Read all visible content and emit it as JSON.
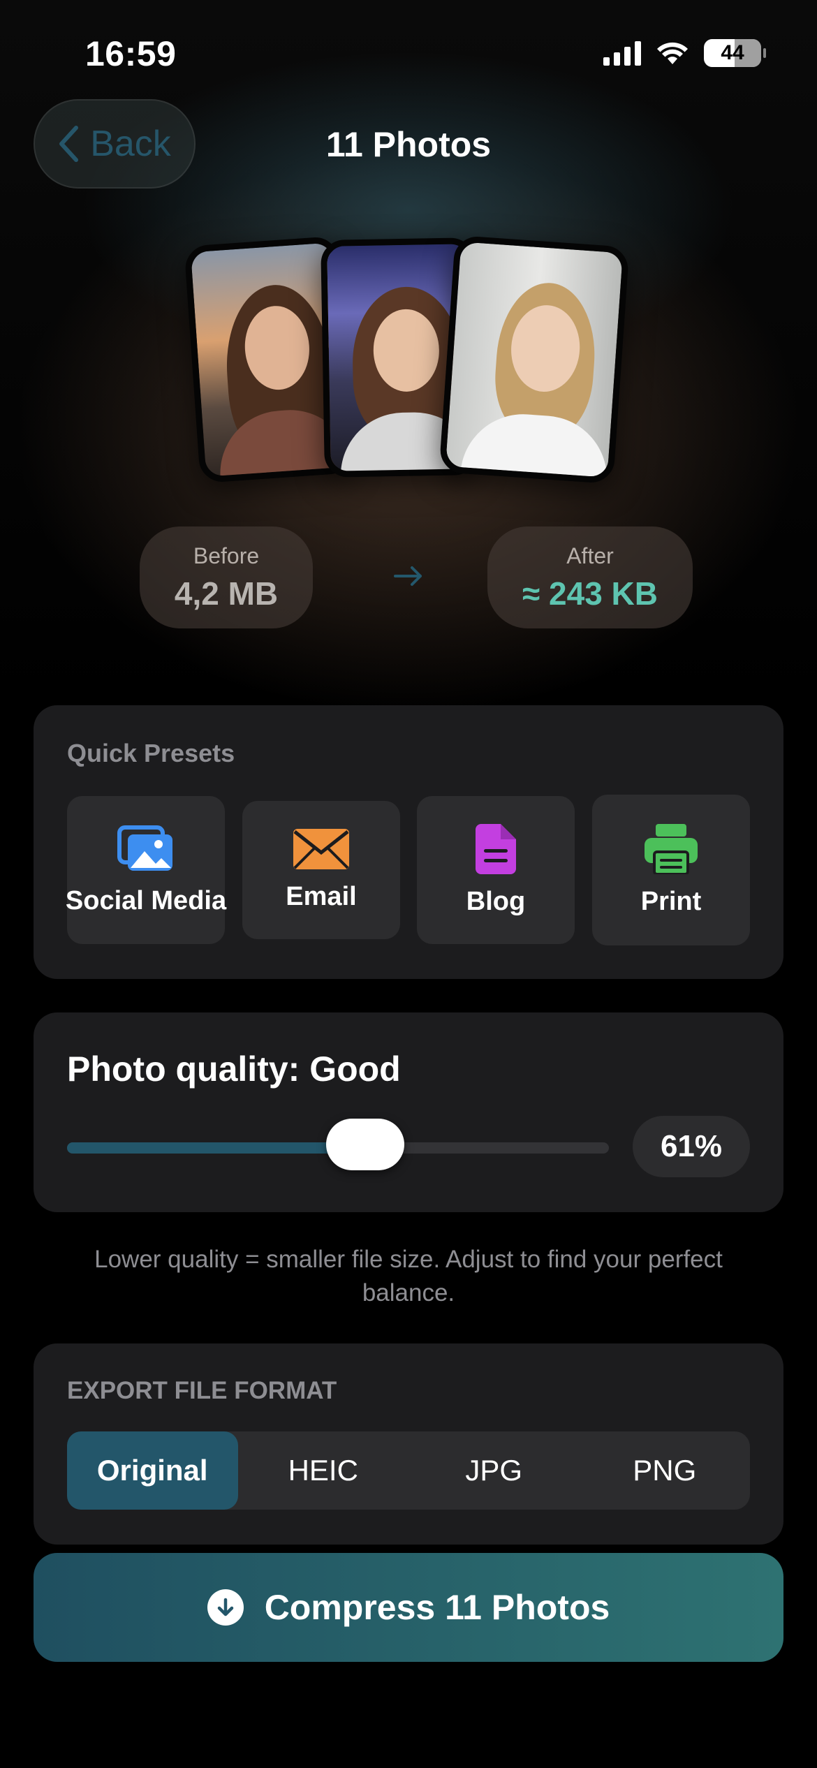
{
  "status_bar": {
    "time": "16:59",
    "battery": "44"
  },
  "header": {
    "back_label": "Back",
    "title": "11 Photos"
  },
  "sizes": {
    "before_label": "Before",
    "before_value": "4,2 MB",
    "after_label": "After",
    "after_value": "≈ 243 KB"
  },
  "presets": {
    "title": "Quick Presets",
    "items": [
      {
        "label": "Social Media",
        "icon": "photos-icon",
        "color": "#3d8ef0"
      },
      {
        "label": "Email",
        "icon": "envelope-icon",
        "color": "#f0923c"
      },
      {
        "label": "Blog",
        "icon": "document-icon",
        "color": "#c33fe0"
      },
      {
        "label": "Print",
        "icon": "printer-icon",
        "color": "#4cc05a"
      }
    ]
  },
  "quality": {
    "title": "Photo quality: Good",
    "percent_label": "61%",
    "value": 0.55
  },
  "hint": "Lower quality = smaller file size. Adjust to find your perfect balance.",
  "format": {
    "title": "EXPORT FILE FORMAT",
    "options": [
      "Original",
      "HEIC",
      "JPG",
      "PNG"
    ],
    "selected": "Original"
  },
  "action": {
    "compress_label": "Compress 11 Photos"
  },
  "colors": {
    "accent": "#23566a",
    "after_value": "#5ec4b0",
    "card_bg": "#1c1c1e"
  }
}
